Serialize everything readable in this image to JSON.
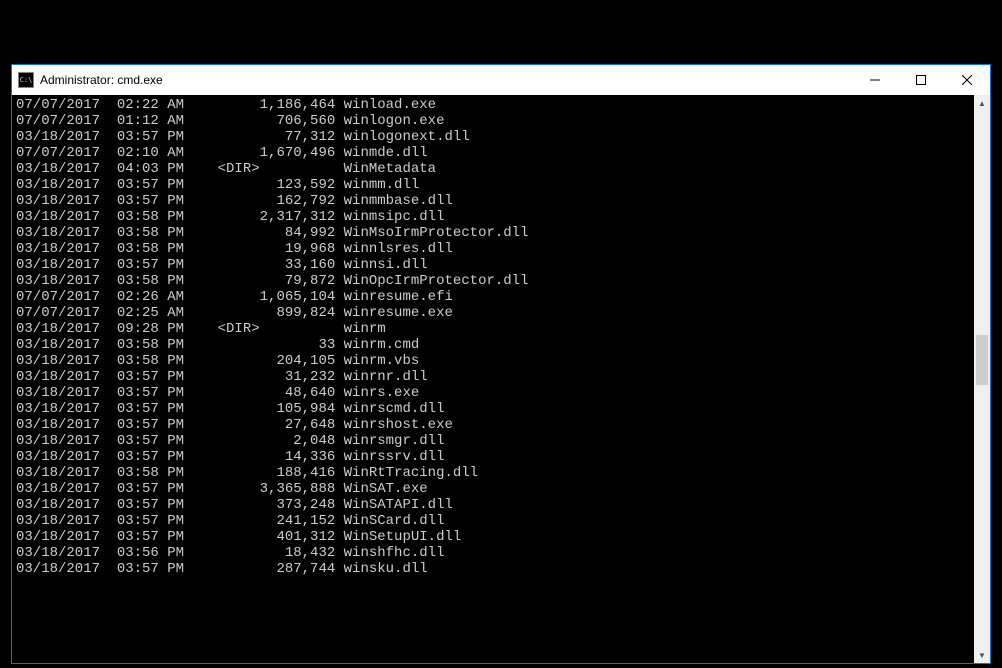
{
  "window": {
    "title": "Administrator: cmd.exe",
    "icon_label": "CMD"
  },
  "listing": [
    {
      "date": "07/07/2017",
      "time": "02:22 AM",
      "dir": false,
      "size": "1,186,464",
      "name": "winload.exe"
    },
    {
      "date": "07/07/2017",
      "time": "01:12 AM",
      "dir": false,
      "size": "706,560",
      "name": "winlogon.exe"
    },
    {
      "date": "03/18/2017",
      "time": "03:57 PM",
      "dir": false,
      "size": "77,312",
      "name": "winlogonext.dll"
    },
    {
      "date": "07/07/2017",
      "time": "02:10 AM",
      "dir": false,
      "size": "1,670,496",
      "name": "winmde.dll"
    },
    {
      "date": "03/18/2017",
      "time": "04:03 PM",
      "dir": true,
      "size": "",
      "name": "WinMetadata"
    },
    {
      "date": "03/18/2017",
      "time": "03:57 PM",
      "dir": false,
      "size": "123,592",
      "name": "winmm.dll"
    },
    {
      "date": "03/18/2017",
      "time": "03:57 PM",
      "dir": false,
      "size": "162,792",
      "name": "winmmbase.dll"
    },
    {
      "date": "03/18/2017",
      "time": "03:58 PM",
      "dir": false,
      "size": "2,317,312",
      "name": "winmsipc.dll"
    },
    {
      "date": "03/18/2017",
      "time": "03:58 PM",
      "dir": false,
      "size": "84,992",
      "name": "WinMsoIrmProtector.dll"
    },
    {
      "date": "03/18/2017",
      "time": "03:58 PM",
      "dir": false,
      "size": "19,968",
      "name": "winnlsres.dll"
    },
    {
      "date": "03/18/2017",
      "time": "03:57 PM",
      "dir": false,
      "size": "33,160",
      "name": "winnsi.dll"
    },
    {
      "date": "03/18/2017",
      "time": "03:58 PM",
      "dir": false,
      "size": "79,872",
      "name": "WinOpcIrmProtector.dll"
    },
    {
      "date": "07/07/2017",
      "time": "02:26 AM",
      "dir": false,
      "size": "1,065,104",
      "name": "winresume.efi"
    },
    {
      "date": "07/07/2017",
      "time": "02:25 AM",
      "dir": false,
      "size": "899,824",
      "name": "winresume.exe"
    },
    {
      "date": "03/18/2017",
      "time": "09:28 PM",
      "dir": true,
      "size": "",
      "name": "winrm"
    },
    {
      "date": "03/18/2017",
      "time": "03:58 PM",
      "dir": false,
      "size": "33",
      "name": "winrm.cmd"
    },
    {
      "date": "03/18/2017",
      "time": "03:58 PM",
      "dir": false,
      "size": "204,105",
      "name": "winrm.vbs"
    },
    {
      "date": "03/18/2017",
      "time": "03:57 PM",
      "dir": false,
      "size": "31,232",
      "name": "winrnr.dll"
    },
    {
      "date": "03/18/2017",
      "time": "03:57 PM",
      "dir": false,
      "size": "48,640",
      "name": "winrs.exe"
    },
    {
      "date": "03/18/2017",
      "time": "03:57 PM",
      "dir": false,
      "size": "105,984",
      "name": "winrscmd.dll"
    },
    {
      "date": "03/18/2017",
      "time": "03:57 PM",
      "dir": false,
      "size": "27,648",
      "name": "winrshost.exe"
    },
    {
      "date": "03/18/2017",
      "time": "03:57 PM",
      "dir": false,
      "size": "2,048",
      "name": "winrsmgr.dll"
    },
    {
      "date": "03/18/2017",
      "time": "03:57 PM",
      "dir": false,
      "size": "14,336",
      "name": "winrssrv.dll"
    },
    {
      "date": "03/18/2017",
      "time": "03:58 PM",
      "dir": false,
      "size": "188,416",
      "name": "WinRtTracing.dll"
    },
    {
      "date": "03/18/2017",
      "time": "03:57 PM",
      "dir": false,
      "size": "3,365,888",
      "name": "WinSAT.exe"
    },
    {
      "date": "03/18/2017",
      "time": "03:57 PM",
      "dir": false,
      "size": "373,248",
      "name": "WinSATAPI.dll"
    },
    {
      "date": "03/18/2017",
      "time": "03:57 PM",
      "dir": false,
      "size": "241,152",
      "name": "WinSCard.dll"
    },
    {
      "date": "03/18/2017",
      "time": "03:57 PM",
      "dir": false,
      "size": "401,312",
      "name": "WinSetupUI.dll"
    },
    {
      "date": "03/18/2017",
      "time": "03:56 PM",
      "dir": false,
      "size": "18,432",
      "name": "winshfhc.dll"
    },
    {
      "date": "03/18/2017",
      "time": "03:57 PM",
      "dir": false,
      "size": "287,744",
      "name": "winsku.dll"
    }
  ]
}
